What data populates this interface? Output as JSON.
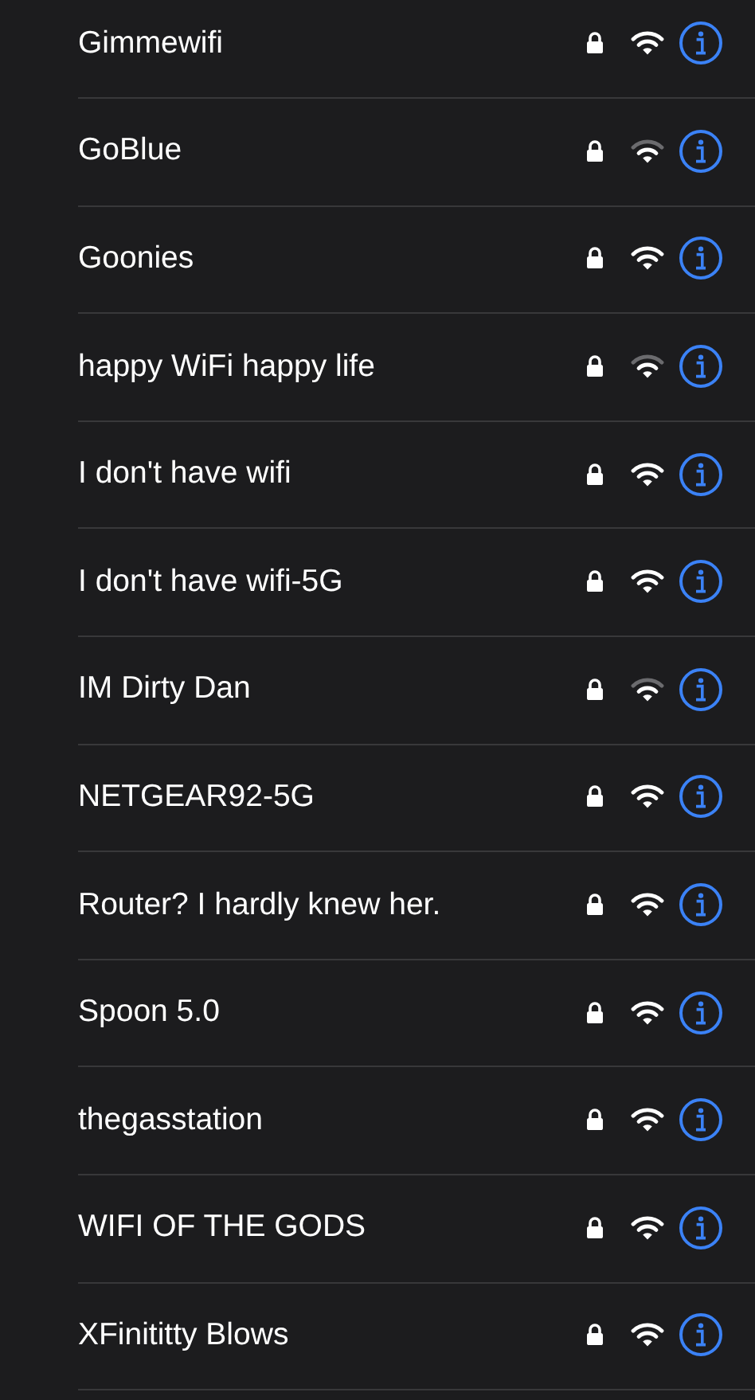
{
  "networks": [
    {
      "name": "Gimmewifi",
      "weak_signal": false
    },
    {
      "name": "GoBlue",
      "weak_signal": true
    },
    {
      "name": "Goonies",
      "weak_signal": false
    },
    {
      "name": "happy WiFi happy life",
      "weak_signal": true
    },
    {
      "name": "I don't have wifi",
      "weak_signal": false
    },
    {
      "name": "I don't have wifi-5G",
      "weak_signal": false
    },
    {
      "name": "IM Dirty Dan",
      "weak_signal": true
    },
    {
      "name": "NETGEAR92-5G",
      "weak_signal": false
    },
    {
      "name": "Router? I hardly knew her.",
      "weak_signal": false
    },
    {
      "name": "Spoon 5.0",
      "weak_signal": false
    },
    {
      "name": "thegasstation",
      "weak_signal": false
    },
    {
      "name": "WIFI OF THE GODS",
      "weak_signal": false
    },
    {
      "name": "XFinititty Blows",
      "weak_signal": false
    }
  ]
}
